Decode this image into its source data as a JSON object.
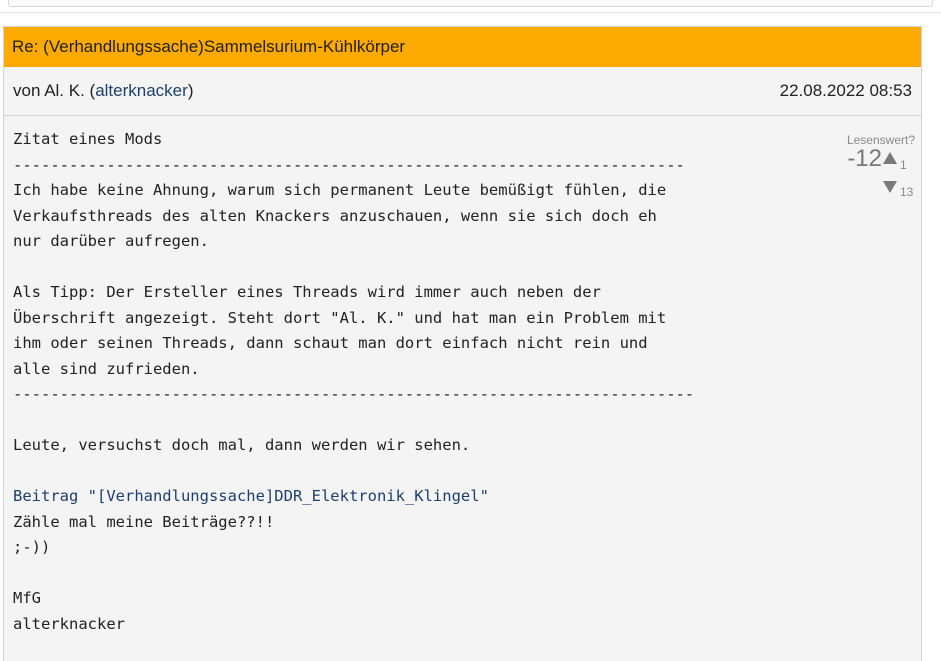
{
  "post": {
    "title": "Re: (Verhandlungssache)Sammelsurium-Kühlkörper",
    "author_prefix": "von Al. K. (",
    "author_username": "alterknacker",
    "author_suffix": ")",
    "date": "22.08.2022 08:53",
    "rating": {
      "label": "Lesenswert?",
      "score": "-12",
      "up_count": "1",
      "down_count": "13"
    },
    "body_lines": [
      "Zitat eines Mods",
      "------------------------------------------------------------------------",
      "Ich habe keine Ahnung, warum sich permanent Leute bemüßigt fühlen, die",
      "Verkaufsthreads des alten Knackers anzuschauen, wenn sie sich doch eh",
      "nur darüber aufregen.",
      "",
      "Als Tipp: Der Ersteller eines Threads wird immer auch neben der",
      "Überschrift angezeigt. Steht dort \"Al. K.\" und hat man ein Problem mit",
      "ihm oder seinen Threads, dann schaut man dort einfach nicht rein und",
      "alle sind zufrieden.",
      "-------------------------------------------------------------------------",
      "",
      "Leute, versuchst doch mal, dann werden wir sehen.",
      "",
      "Beitrag \"[Verhandlungssache]DDR_Elektronik_Klingel\"",
      "Zähle mal meine Beiträge??!!",
      ";-))",
      "",
      "MfG",
      "alterknacker"
    ]
  },
  "colors": {
    "header_bg": "#ffaa00",
    "link": "#1d3f6e",
    "post_bg": "#f4f4f4"
  }
}
